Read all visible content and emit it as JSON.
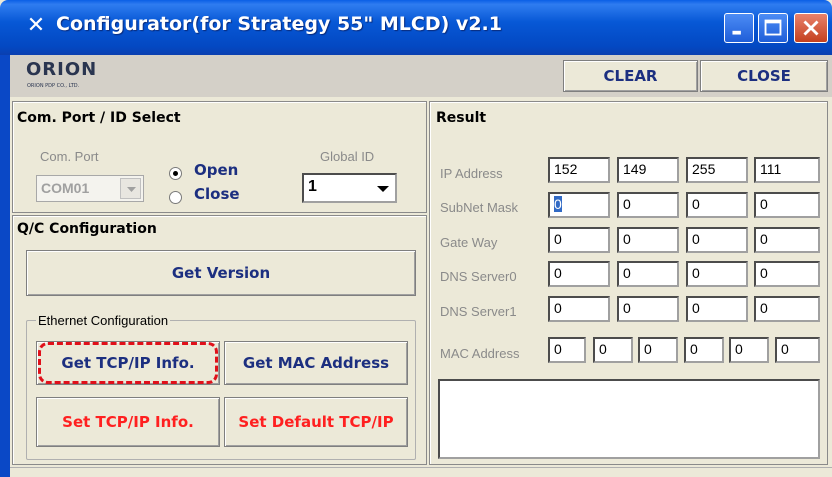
{
  "window": {
    "title": "Configurator(for Strategy 55\" MLCD) v2.1",
    "icon": "tools-icon"
  },
  "toolbar": {
    "logo_text": "ORION",
    "logo_sub": "ORION PDP CO., LTD.",
    "clear_label": "CLEAR",
    "close_label": "CLOSE"
  },
  "port_panel": {
    "title": "Com. Port / ID Select",
    "com_port_label": "Com. Port",
    "com_port_value": "COM01",
    "open_label": "Open",
    "close_label": "Close",
    "selected_radio": "Open",
    "global_id_label": "Global ID",
    "global_id_value": "1"
  },
  "qc_panel": {
    "title": "Q/C Configuration",
    "get_version_label": "Get Version",
    "ethernet_group_label": "Ethernet Configuration",
    "get_tcpip_label": "Get TCP/IP Info.",
    "get_mac_label": "Get MAC Address",
    "set_tcpip_label": "Set TCP/IP Info.",
    "set_default_label": "Set Default TCP/IP"
  },
  "result_panel": {
    "title": "Result",
    "ip_label": "IP Address",
    "ip": [
      "152",
      "149",
      "255",
      "111"
    ],
    "subnet_label": "SubNet Mask",
    "subnet": [
      "0",
      "0",
      "0",
      "0"
    ],
    "gateway_label": "Gate Way",
    "gateway": [
      "0",
      "0",
      "0",
      "0"
    ],
    "dns0_label": "DNS Server0",
    "dns0": [
      "0",
      "0",
      "0",
      "0"
    ],
    "dns1_label": "DNS Server1",
    "dns1": [
      "0",
      "0",
      "0",
      "0"
    ],
    "mac_label": "MAC Address",
    "mac": [
      "0",
      "0",
      "0",
      "0",
      "0",
      "0"
    ],
    "output_text": ""
  }
}
